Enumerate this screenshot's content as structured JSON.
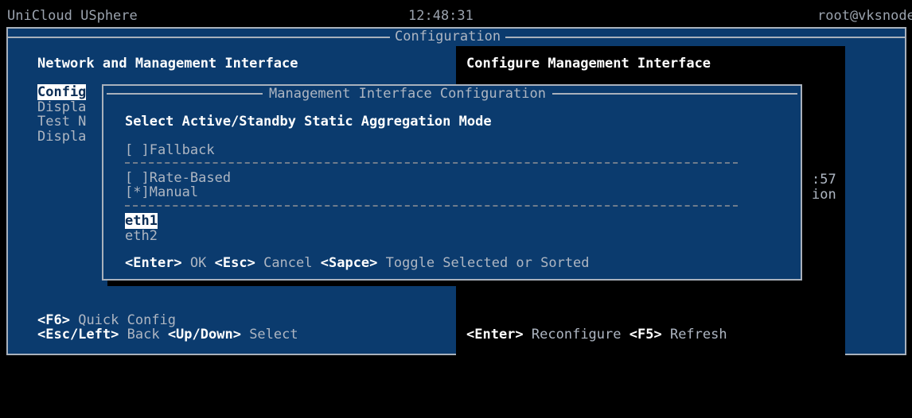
{
  "header": {
    "app_title": "UniCloud USphere",
    "clock": "12:48:31",
    "user_host": "root@vksnode"
  },
  "screen": {
    "title": "Configuration",
    "left_heading": "Network and Management Interface",
    "right_heading": "Configure Management Interface",
    "left_items": [
      {
        "label": "Config"
      },
      {
        "label": "Displa"
      },
      {
        "label": "Test N"
      },
      {
        "label": "Displa"
      }
    ],
    "right_partial": [
      ":57",
      "ion"
    ],
    "footer_left": {
      "line1": {
        "key": "<F6>",
        "text": "Quick Config"
      },
      "line2": [
        {
          "key": "<Esc/Left>",
          "text": "Back"
        },
        {
          "key": "<Up/Down>",
          "text": "Select"
        }
      ]
    },
    "footer_right": [
      {
        "key": "<Enter>",
        "text": "Reconfigure"
      },
      {
        "key": "<F5>",
        "text": "Refresh"
      }
    ]
  },
  "dialog": {
    "title": "Management Interface Configuration",
    "prompt": "Select Active/Standby Static Aggregation Mode",
    "options": [
      {
        "checkbox": "[ ]",
        "label": "Fallback"
      },
      {
        "checkbox": "[ ]",
        "label": "Rate-Based"
      },
      {
        "checkbox": "[*]",
        "label": "Manual"
      }
    ],
    "interfaces": [
      {
        "label": "eth1",
        "selected": true
      },
      {
        "label": "eth2",
        "selected": false
      }
    ],
    "hints": [
      {
        "key": "<Enter>",
        "text": "OK"
      },
      {
        "key": "<Esc>",
        "text": "Cancel"
      },
      {
        "key": "<Sapce>",
        "text": "Toggle Selected or Sorted"
      }
    ]
  }
}
